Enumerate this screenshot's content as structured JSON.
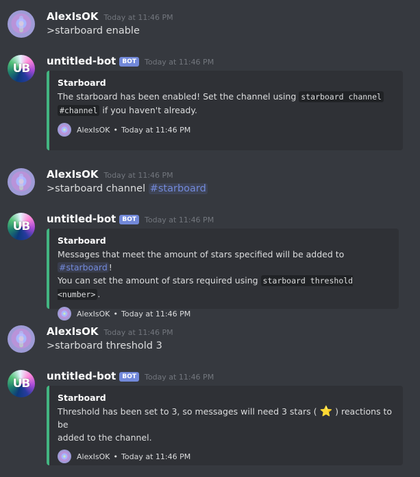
{
  "messages": [
    {
      "author": "AlexIsOK",
      "timestamp": "Today at 11:46 PM",
      "text": ">starboard enable"
    },
    {
      "author": "untitled-bot",
      "badge": "BOT",
      "timestamp": "Today at 11:46 PM",
      "embed": {
        "title": "Starboard",
        "line1_pre": "The starboard has been enabled! Set the channel using",
        "code1": "starboard channel",
        "code2": "#channel",
        "line2_post": "if you haven't already.",
        "footer_name": "AlexIsOK",
        "footer_sep": "•",
        "footer_time": "Today at 11:46 PM"
      }
    },
    {
      "author": "AlexIsOK",
      "timestamp": "Today at 11:46 PM",
      "text": ">starboard channel",
      "mention": "#starboard"
    },
    {
      "author": "untitled-bot",
      "badge": "BOT",
      "timestamp": "Today at 11:46 PM",
      "embed": {
        "title": "Starboard",
        "line1_pre": "Messages that meet the amount of stars specified will be added to",
        "mention": "#starboard",
        "line1_post": "!",
        "line2_pre": "You can set the amount of stars required using",
        "code": "starboard threshold <number>",
        "line2_post": ".",
        "footer_name": "AlexIsOK",
        "footer_sep": "•",
        "footer_time": "Today at 11:46 PM"
      }
    },
    {
      "author": "AlexIsOK",
      "timestamp": "Today at 11:46 PM",
      "text": ">starboard threshold 3"
    },
    {
      "author": "untitled-bot",
      "badge": "BOT",
      "timestamp": "Today at 11:46 PM",
      "embed": {
        "title": "Starboard",
        "line1_pre": "Threshold has been set to 3, so messages will need 3 stars (",
        "star": "⭐",
        "line1_post": ") reactions to be",
        "line2": "added to the channel.",
        "footer_name": "AlexIsOK",
        "footer_sep": "•",
        "footer_time": "Today at 11:46 PM"
      }
    }
  ],
  "bot_logo": "UB",
  "colors": {
    "background": "#36393f",
    "embed_bg": "#2f3136",
    "embed_border": "#43b581",
    "mention": "#7289da",
    "badge": "#7289da"
  }
}
